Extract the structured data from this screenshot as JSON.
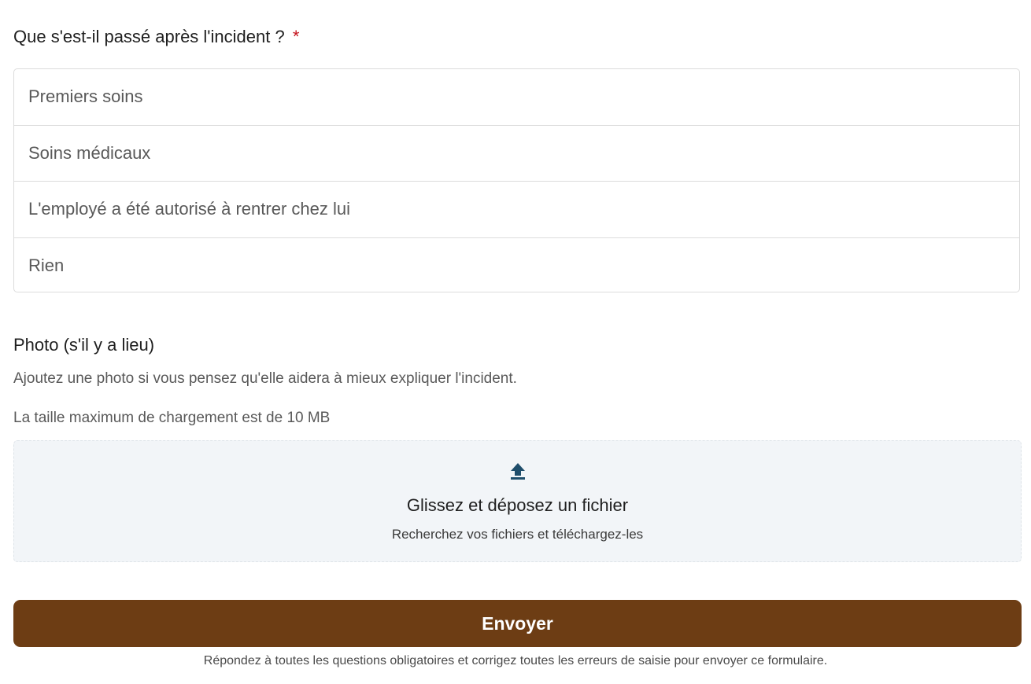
{
  "question": {
    "label": "Que s'est-il passé après l'incident ?",
    "required_mark": "*",
    "options": [
      {
        "label": "Premiers soins"
      },
      {
        "label": "Soins médicaux"
      },
      {
        "label": "L'employé a été autorisé à rentrer chez lui"
      },
      {
        "label": "Rien"
      }
    ]
  },
  "photo": {
    "title": "Photo (s'il y a lieu)",
    "help": "Ajoutez une photo si vous pensez qu'elle aidera à mieux expliquer l'incident.",
    "size_limit": "La taille maximum de chargement est de 10 MB",
    "dropzone": {
      "icon": "upload-arrow-icon",
      "title": "Glissez et déposez un fichier",
      "subtitle": "Recherchez vos fichiers et téléchargez-les"
    }
  },
  "submit": {
    "label": "Envoyer",
    "note": "Répondez à toutes les questions obligatoires et corrigez toutes les erreurs de saisie pour envoyer ce formulaire."
  },
  "colors": {
    "accent": "#6d3d14",
    "required": "#c4121b",
    "dropzone_bg": "#f2f5f8",
    "upload_icon": "#1f4e6b"
  }
}
